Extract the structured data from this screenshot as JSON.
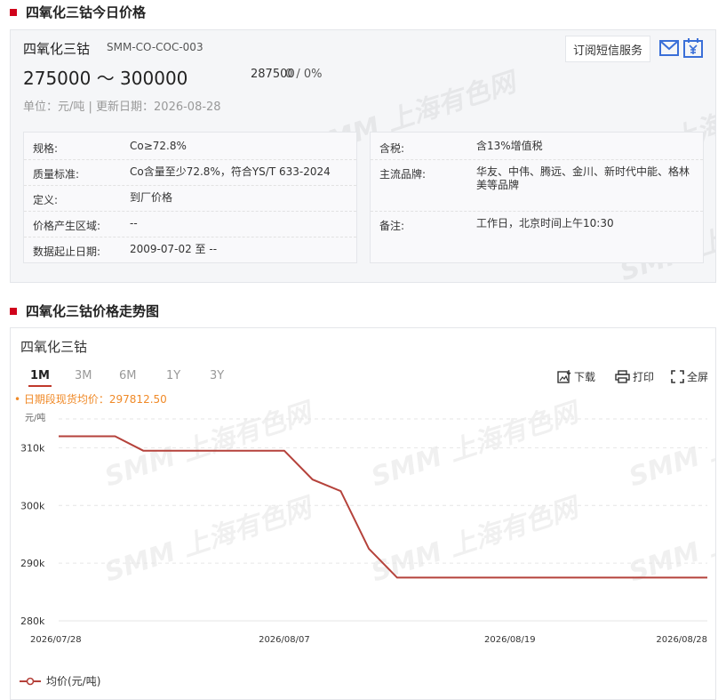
{
  "section1": {
    "title": "四氧化三钴今日价格"
  },
  "product": {
    "name": "四氧化三钴",
    "code": "SMM-CO-COC-003",
    "price_range": "275000 ～ 300000",
    "average": "287500",
    "change": "0 / 0%",
    "meta": "单位：元/吨  |  更新日期：2026-08-28"
  },
  "actions": {
    "subscribe_label": "订阅短信服务",
    "mail_icon": "mail-icon",
    "yuan_icon": "yuan-calendar-icon"
  },
  "info_left": [
    {
      "key": "规格:",
      "value": "Co≥72.8%"
    },
    {
      "key": "质量标准:",
      "value": "Co含量至少72.8%，符合YS/T 633-2024"
    },
    {
      "key": "定义:",
      "value": "到厂价格"
    },
    {
      "key": "价格产生区域:",
      "value": "--"
    },
    {
      "key": "数据起止日期:",
      "value": "2009-07-02 至 --"
    }
  ],
  "info_right": [
    {
      "key": "含税:",
      "value": "含13%增值税"
    },
    {
      "key": "主流品牌:",
      "value": "华友、中伟、腾远、金川、新时代中能、格林美等品牌"
    },
    {
      "key": "备注:",
      "value": "工作日，北京时间上午10:30"
    }
  ],
  "section2": {
    "title": "四氧化三钴价格走势图"
  },
  "chart_panel": {
    "title": "四氧化三钴",
    "tabs": [
      "1M",
      "3M",
      "6M",
      "1Y",
      "3Y"
    ],
    "active_tab": "1M",
    "download_label": "下载",
    "print_label": "打印",
    "fullscreen_label": "全屏",
    "period_avg": "• 日期段现货均价：297812.50"
  },
  "watermark": "SMM 上海有色网",
  "chart_data": {
    "type": "line",
    "ylabel": "元/吨",
    "ylim": [
      280000,
      315000
    ],
    "yticks": [
      280000,
      290000,
      300000,
      310000
    ],
    "ytick_labels": [
      "280k",
      "290k",
      "300k",
      "310k"
    ],
    "xtick_labels": [
      "2026/07/28",
      "2026/08/07",
      "2026/08/19",
      "2026/08/28"
    ],
    "grid": "horizontal-dashed",
    "legend_position": "bottom-left",
    "series": [
      {
        "name": "均价(元/吨)",
        "color": "#b5423b",
        "x": [
          "2026/07/28",
          "2026/07/29",
          "2026/07/30",
          "2026/07/31",
          "2026/08/01",
          "2026/08/04",
          "2026/08/05",
          "2026/08/06",
          "2026/08/07",
          "2026/08/08",
          "2026/08/11",
          "2026/08/12",
          "2026/08/13",
          "2026/08/14",
          "2026/08/15",
          "2026/08/18",
          "2026/08/19",
          "2026/08/20",
          "2026/08/21",
          "2026/08/22",
          "2026/08/25",
          "2026/08/26",
          "2026/08/27",
          "2026/08/28"
        ],
        "values": [
          312000,
          312000,
          312000,
          309500,
          309500,
          309500,
          309500,
          309500,
          309500,
          304500,
          302500,
          292500,
          287500,
          287500,
          287500,
          287500,
          287500,
          287500,
          287500,
          287500,
          287500,
          287500,
          287500,
          287500
        ]
      }
    ]
  }
}
